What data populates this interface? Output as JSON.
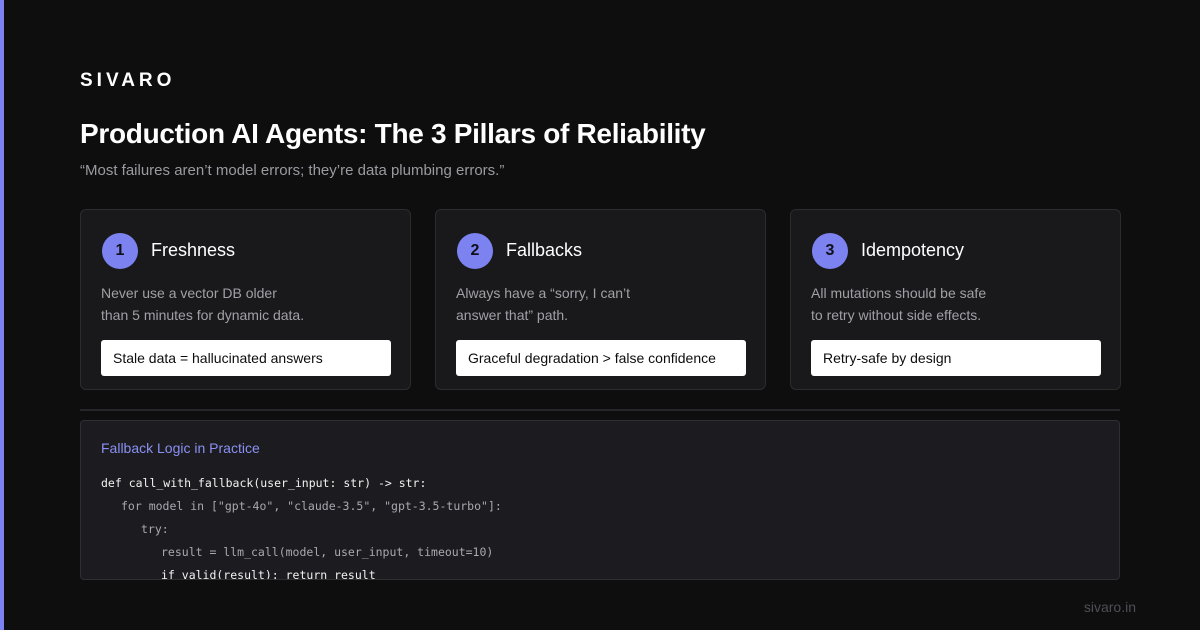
{
  "brand": "SIVARO",
  "title": "Production AI Agents: The 3 Pillars of Reliability",
  "subtitle": "“Most failures aren’t model errors; they’re data plumbing errors.”",
  "cards": [
    {
      "number": "1",
      "title": "Freshness",
      "desc_line1": "Never use a vector DB older",
      "desc_line2": "than 5 minutes for dynamic data.",
      "pill": "Stale data = hallucinated answers"
    },
    {
      "number": "2",
      "title": "Fallbacks",
      "desc_line1": "Always have a “sorry, I can’t",
      "desc_line2": "answer that” path.",
      "pill": "Graceful degradation > false confidence"
    },
    {
      "number": "3",
      "title": "Idempotency",
      "desc_line1": "All mutations should be safe",
      "desc_line2": "to retry without side effects.",
      "pill": "Retry-safe by design"
    }
  ],
  "code_panel": {
    "title": "Fallback Logic in Practice",
    "lines": [
      "def call_with_fallback(user_input: str) -> str:",
      "for model in [\"gpt-4o\", \"claude-3.5\", \"gpt-3.5-turbo\"]:",
      "try:",
      "result = llm_call(model, user_input, timeout=10)",
      "if valid(result): return result"
    ]
  },
  "footer": "sivaro.in",
  "colors": {
    "accent": "#7c83f0",
    "background": "#0e0e0f",
    "card": "#19191c"
  }
}
